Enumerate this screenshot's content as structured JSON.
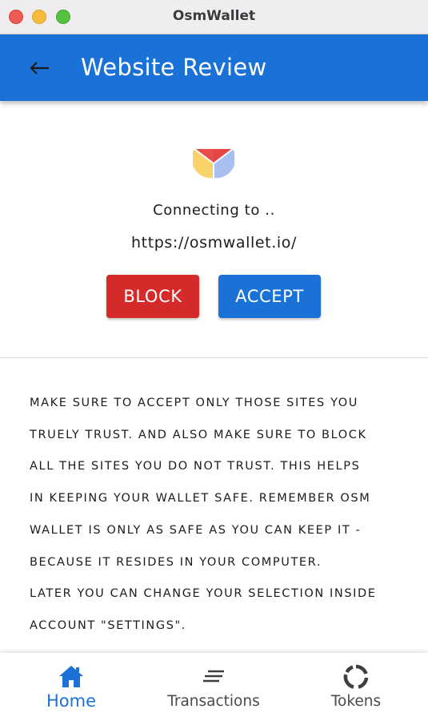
{
  "window": {
    "title": "OsmWallet"
  },
  "appbar": {
    "title": "Website Review",
    "back_icon": "arrow-back-icon"
  },
  "review": {
    "logo_icon": "osmwallet-logo-icon",
    "connecting_text": "Connecting to ..",
    "url": "https://osmwallet.io/",
    "block_label": "BLOCK",
    "accept_label": "ACCEPT",
    "notice_lines": [
      "MAKE SURE TO ACCEPT ONLY THOSE SITES YOU",
      "TRUELY TRUST. AND ALSO MAKE SURE TO BLOCK",
      "ALL THE SITES YOU DO NOT TRUST. THIS HELPS",
      "IN KEEPING YOUR WALLET SAFE. REMEMBER OSM",
      "WALLET IS ONLY AS SAFE AS YOU CAN KEEP IT -",
      "BECAUSE IT RESIDES IN YOUR COMPUTER.",
      "LATER YOU CAN CHANGE YOUR SELECTION INSIDE",
      "ACCOUNT \"SETTINGS\"."
    ]
  },
  "bottom_nav": {
    "items": [
      {
        "label": "Home",
        "icon": "home-icon",
        "active": true
      },
      {
        "label": "Transactions",
        "icon": "list-icon",
        "active": false
      },
      {
        "label": "Tokens",
        "icon": "tokens-ring-icon",
        "active": false
      }
    ]
  },
  "colors": {
    "primary": "#1a72d6",
    "danger": "#d42a2a",
    "titlebar_bg": "#efedf0",
    "traffic_red": "#ee5b55",
    "traffic_yellow": "#f6bd3c",
    "traffic_green": "#53c33f"
  }
}
